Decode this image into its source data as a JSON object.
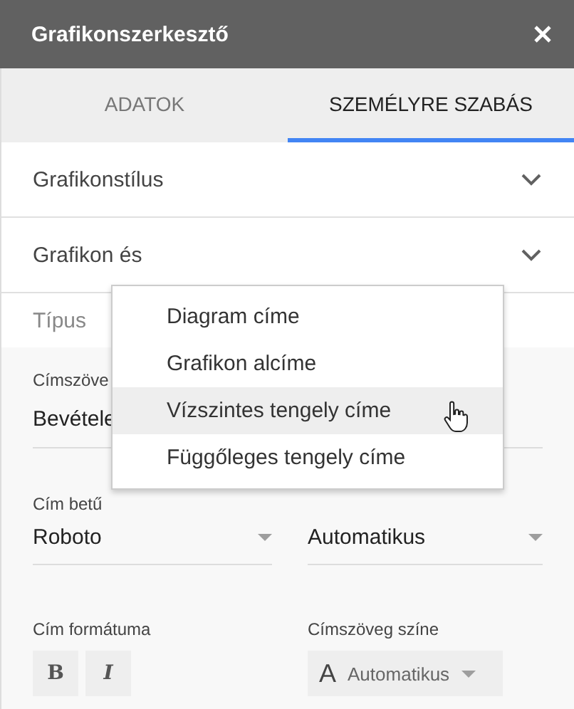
{
  "window": {
    "title": "Grafikonszerkesztő"
  },
  "tabs": [
    {
      "label": "ADATOK",
      "selected": false
    },
    {
      "label": "SZEMÉLYRE SZABÁS",
      "selected": true
    }
  ],
  "sections": [
    {
      "label": "Grafikonstílus"
    },
    {
      "label": "Grafikon és"
    }
  ],
  "type_label": "Típus",
  "title_text": {
    "label": "Címszöve",
    "value": "Bevétele"
  },
  "title_font": {
    "label": "Cím betű",
    "value": "Roboto"
  },
  "title_size": {
    "value": "Automatikus"
  },
  "title_format": {
    "label": "Cím formátuma",
    "buttons": [
      {
        "label": "B",
        "kind": "bold"
      },
      {
        "label": "I",
        "kind": "italic"
      }
    ]
  },
  "title_color": {
    "label": "Címszöveg színe",
    "glyph": "A",
    "value": "Automatikus"
  },
  "menu": [
    {
      "label": "Diagram címe",
      "selected": false
    },
    {
      "label": "Grafikon alcíme",
      "selected": false
    },
    {
      "label": "Vízszintes tengely címe",
      "selected": true
    },
    {
      "label": "Függőleges tengely címe",
      "selected": false
    }
  ]
}
